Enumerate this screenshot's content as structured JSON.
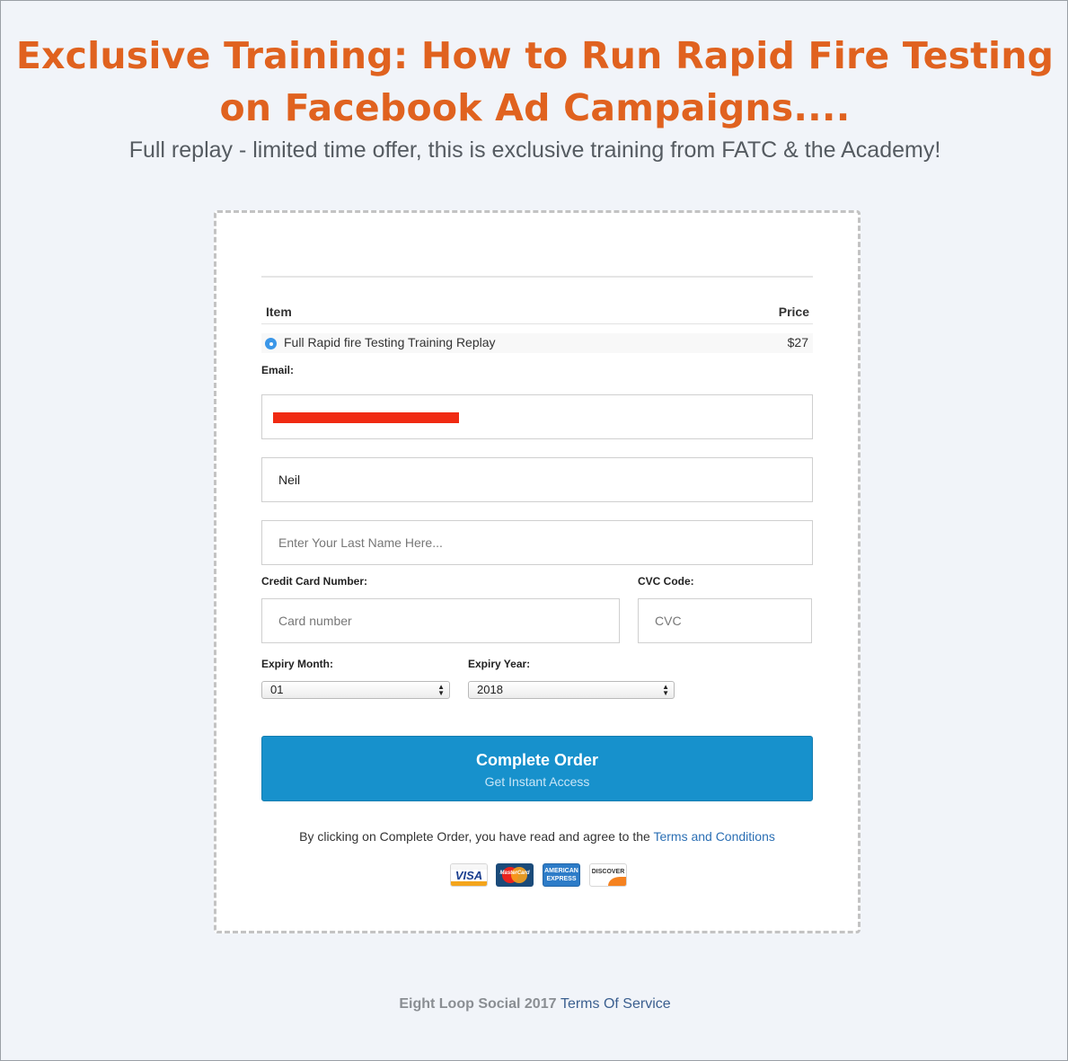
{
  "header": {
    "headline": "Exclusive Training: How to Run Rapid Fire Testing on Facebook Ad Campaigns....",
    "subheadline": "Full replay - limited time offer, this is exclusive training from FATC & the Academy!"
  },
  "order_table": {
    "col_item": "Item",
    "col_price": "Price",
    "product_name": "Full Rapid fire Testing Training Replay",
    "product_price": "$27"
  },
  "form": {
    "email_label": "Email:",
    "first_name_value": "Neil",
    "last_name_placeholder": "Enter Your Last Name Here...",
    "card_label": "Credit Card Number:",
    "card_placeholder": "Card number",
    "cvc_label": "CVC Code:",
    "cvc_placeholder": "CVC",
    "expiry_month_label": "Expiry Month:",
    "expiry_month_value": "01",
    "expiry_year_label": "Expiry Year:",
    "expiry_year_value": "2018"
  },
  "button": {
    "title": "Complete Order",
    "subtitle": "Get Instant Access"
  },
  "agreement": {
    "text": "By clicking on Complete Order, you have read and agree to the ",
    "link": "Terms and Conditions"
  },
  "payment_logos": {
    "visa": "VISA",
    "mastercard": "MasterCard",
    "amex": "AMERICAN EXPRESS",
    "discover": "DISCOVER"
  },
  "footer": {
    "company": "Eight Loop Social 2017",
    "link": "Terms Of Service"
  },
  "colors": {
    "headline": "#e0621f",
    "button": "#1791cc",
    "background": "#f1f4f9",
    "redaction": "#f02a12"
  }
}
